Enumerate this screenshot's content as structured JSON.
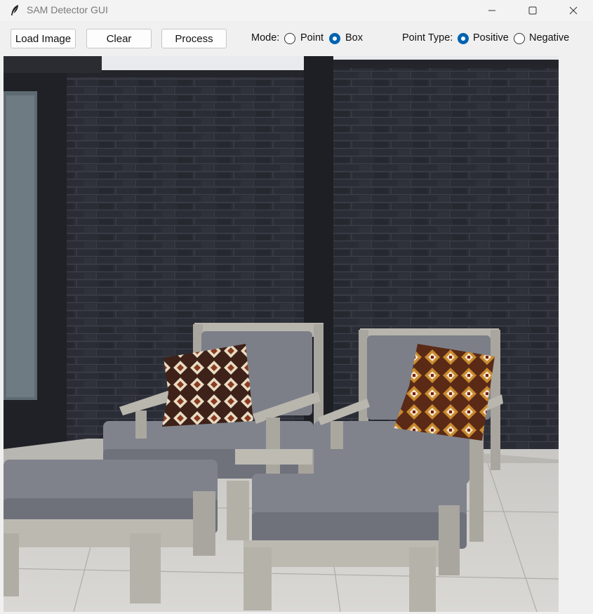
{
  "window": {
    "title": "SAM Detector GUI",
    "app_icon": "feather-icon"
  },
  "toolbar": {
    "load_label": "Load Image",
    "clear_label": "Clear",
    "process_label": "Process",
    "mode_label": "Mode:",
    "mode_options": [
      {
        "label": "Point",
        "selected": false
      },
      {
        "label": "Box",
        "selected": true
      }
    ],
    "point_type_label": "Point Type:",
    "point_type_options": [
      {
        "label": "Positive",
        "selected": true
      },
      {
        "label": "Negative",
        "selected": false
      }
    ]
  },
  "canvas": {
    "content": "loaded-photo"
  },
  "colors": {
    "accent": "#0063b1",
    "background": "#f0f0f0",
    "brick": "#2b2d36",
    "cushion": "#7c7f88",
    "wood": "#b9b6ae"
  }
}
